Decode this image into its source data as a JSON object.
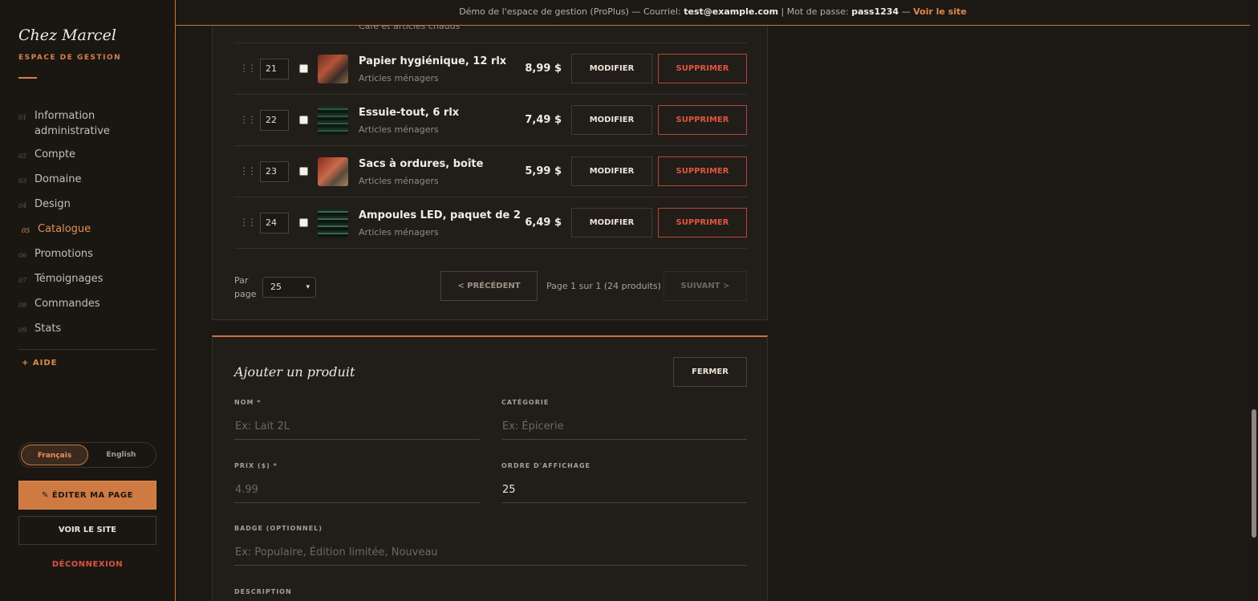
{
  "banner": {
    "prefix": "Démo de l'espace de gestion (ProPlus) — Courriel: ",
    "email": "test@example.com",
    "middle": " | Mot de passe: ",
    "password": "pass1234",
    "dash": " — ",
    "site_link": "Voir le site"
  },
  "sidebar": {
    "brand": "Chez Marcel",
    "subtitle": "ESPACE DE GESTION",
    "items": [
      {
        "num": "01",
        "label": "Information administrative"
      },
      {
        "num": "02",
        "label": "Compte"
      },
      {
        "num": "03",
        "label": "Domaine"
      },
      {
        "num": "04",
        "label": "Design"
      },
      {
        "num": "05",
        "label": "Catalogue"
      },
      {
        "num": "06",
        "label": "Promotions"
      },
      {
        "num": "07",
        "label": "Témoignages"
      },
      {
        "num": "08",
        "label": "Commandes"
      },
      {
        "num": "09",
        "label": "Stats"
      }
    ],
    "active_index": 4,
    "help": "+  AIDE",
    "lang_fr": "Français",
    "lang_en": "English",
    "edit_page": "✎ ÉDITER MA PAGE",
    "view_site": "VOIR LE SITE",
    "logout": "DÉCONNEXION"
  },
  "catalog": {
    "partial_row": {
      "category": "Café et articles chauds"
    },
    "rows": [
      {
        "order": "21",
        "name": "Papier hygiénique, 12 rlx",
        "category": "Articles ménagers",
        "price": "8,99 $"
      },
      {
        "order": "22",
        "name": "Essuie-tout, 6 rlx",
        "category": "Articles ménagers",
        "price": "7,49 $"
      },
      {
        "order": "23",
        "name": "Sacs à ordures, boîte",
        "category": "Articles ménagers",
        "price": "5,99 $"
      },
      {
        "order": "24",
        "name": "Ampoules LED, paquet de 2",
        "category": "Articles ménagers",
        "price": "6,49 $"
      }
    ],
    "edit_label": "MODIFIER",
    "delete_label": "SUPPRIMER",
    "per_page_label": "Par page",
    "per_page_value": "25",
    "prev_label": "< PRÉCÉDENT",
    "page_info": "Page 1 sur 1 (24 produits)",
    "next_label": "SUIVANT >"
  },
  "add_form": {
    "title": "Ajouter un produit",
    "close_label": "FERMER",
    "name_label": "NOM *",
    "name_placeholder": "Ex: Lait 2L",
    "category_label": "CATÉGORIE",
    "category_placeholder": "Ex: Épicerie",
    "price_label": "PRIX ($) *",
    "price_placeholder": "4.99",
    "order_label": "ORDRE D'AFFICHAGE",
    "order_value": "25",
    "badge_label": "BADGE (OPTIONNEL)",
    "badge_placeholder": "Ex: Populaire, Édition limitée, Nouveau",
    "description_label": "DESCRIPTION"
  },
  "colors": {
    "accent": "#cf7a42",
    "danger": "#e0553f",
    "background": "#1c1915"
  }
}
